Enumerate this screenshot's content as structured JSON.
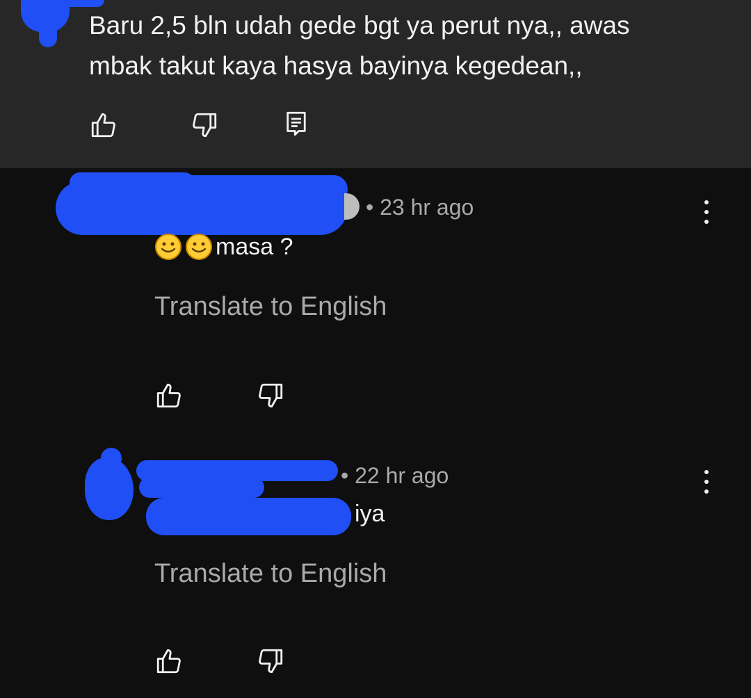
{
  "top_comment": {
    "text": "Baru 2,5 bln udah gede bgt ya perut nya,,  awas\nmbak takut kaya hasya bayinya kegedean,,"
  },
  "replies": [
    {
      "time": "• 23 hr ago",
      "text": "masa ?",
      "emoji_count": 2,
      "translate": "Translate to English"
    },
    {
      "time": "• 22 hr ago",
      "text": "iya",
      "translate": "Translate to English"
    }
  ],
  "icons": {
    "like": "thumbs-up-icon",
    "dislike": "thumbs-down-icon",
    "reply": "comment-reply-icon",
    "more": "more-vert-icon"
  },
  "colors": {
    "background": "#0f0f0f",
    "highlight_background": "#272727",
    "redaction": "#1f4ff5",
    "secondary_text": "#aaaaaa"
  }
}
